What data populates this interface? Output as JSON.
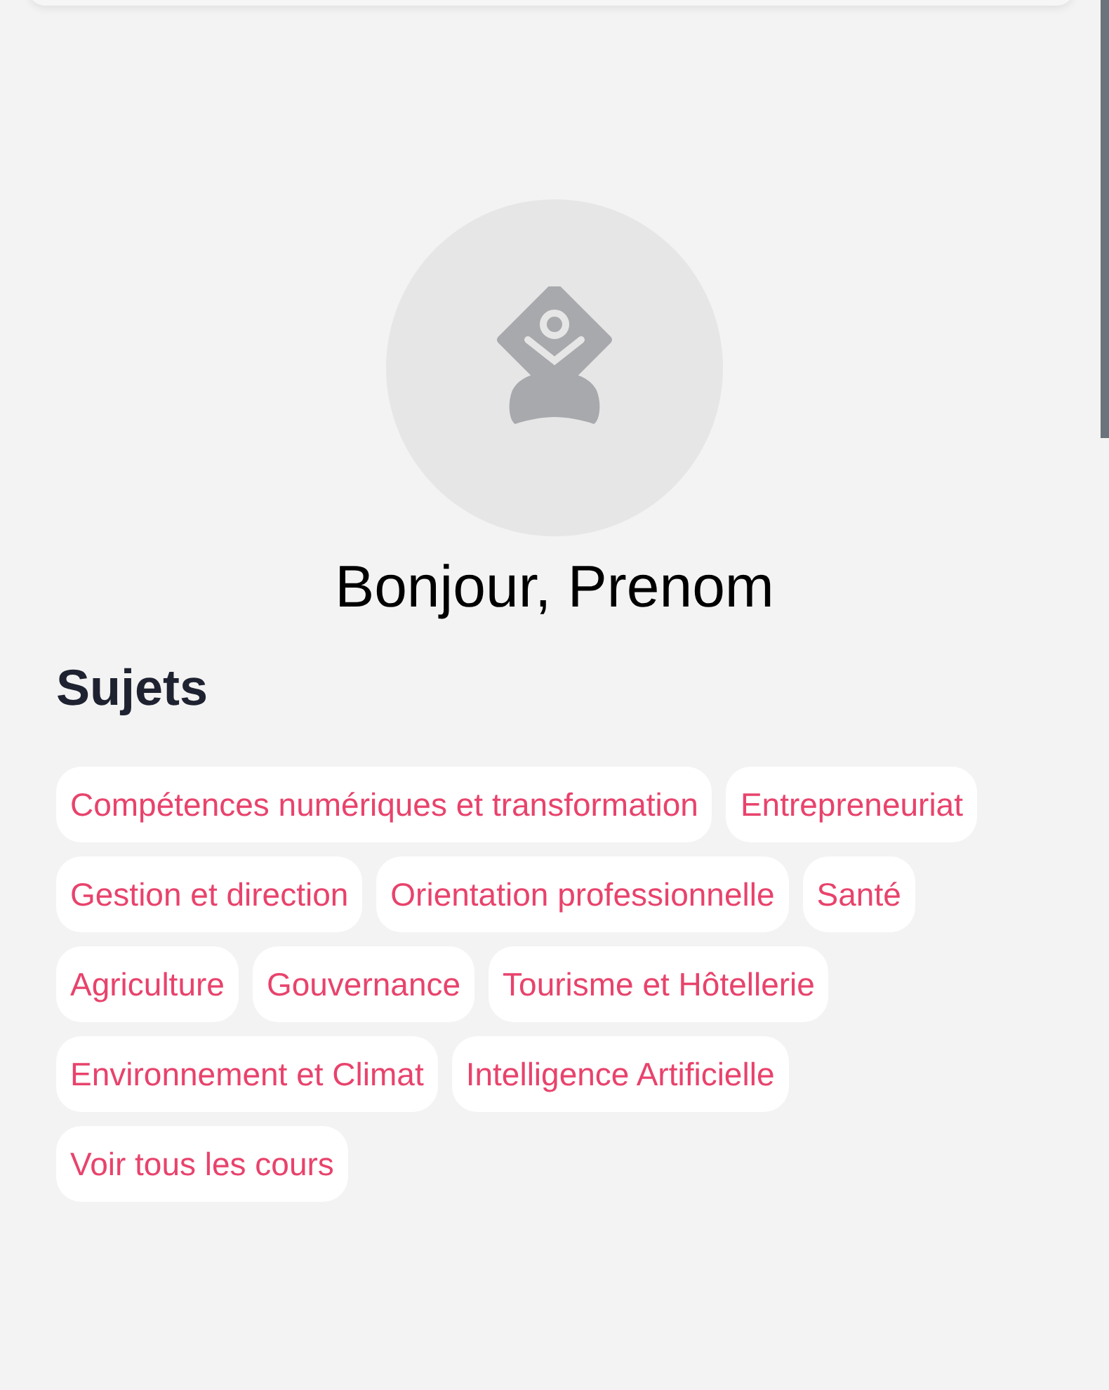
{
  "greeting": "Bonjour, Prenom",
  "subjects": {
    "title": "Sujets",
    "tags": [
      {
        "label": "Compétences numériques et transformation"
      },
      {
        "label": "Entrepreneuriat"
      },
      {
        "label": "Gestion et direction"
      },
      {
        "label": "Orientation professionnelle"
      },
      {
        "label": "Santé"
      },
      {
        "label": "Agriculture"
      },
      {
        "label": "Gouvernance"
      },
      {
        "label": "Tourisme et Hôtellerie"
      },
      {
        "label": "Environnement et Climat"
      },
      {
        "label": "Intelligence Artificielle"
      },
      {
        "label": "Voir tous les cours"
      }
    ]
  }
}
